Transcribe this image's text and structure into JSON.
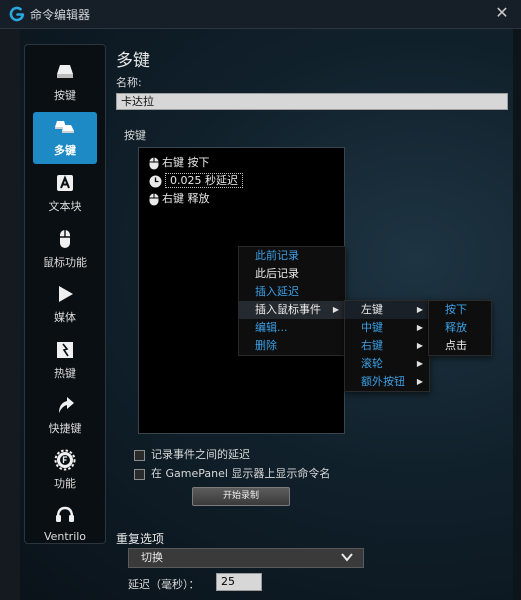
{
  "window": {
    "title": "命令编辑器"
  },
  "sidebar": {
    "items": [
      {
        "label": "按键",
        "icon": "key-icon",
        "active": false
      },
      {
        "label": "多键",
        "icon": "multi-key-icon",
        "active": true
      },
      {
        "label": "文本块",
        "icon": "text-block-icon",
        "active": false
      },
      {
        "label": "鼠标功能",
        "icon": "mouse-icon",
        "active": false
      },
      {
        "label": "媒体",
        "icon": "media-play-icon",
        "active": false
      },
      {
        "label": "热键",
        "icon": "hotkey-icon",
        "active": false
      },
      {
        "label": "快捷键",
        "icon": "shortcut-arrow-icon",
        "active": false
      },
      {
        "label": "功能",
        "icon": "function-gear-icon",
        "active": false
      },
      {
        "label": "Ventrilo",
        "icon": "headset-icon",
        "active": false
      }
    ]
  },
  "main": {
    "title": "多键",
    "name_label": "名称:",
    "name_value": "卡达拉",
    "keys_label": "按键",
    "events": [
      {
        "icon": "mouse-icon",
        "text": "右键 按下"
      },
      {
        "icon": "clock-icon",
        "text": "0.025 秒延迟"
      },
      {
        "icon": "mouse-icon",
        "text": "右键 释放"
      }
    ],
    "checkbox_record_delay": "记录事件之间的延迟",
    "checkbox_show_name": "在 GamePanel 显示器上显示命令名",
    "record_button": "开始录制"
  },
  "context_menu": {
    "items": [
      {
        "label": "此前记录",
        "color": "blue"
      },
      {
        "label": "此后记录",
        "color": "white"
      },
      {
        "label": "插入延迟",
        "color": "blue"
      },
      {
        "label": "插入鼠标事件",
        "color": "white",
        "has_submenu": true
      },
      {
        "label": "编辑...",
        "color": "blue"
      },
      {
        "label": "删除",
        "color": "blue"
      }
    ]
  },
  "submenu_mouse": {
    "items": [
      {
        "label": "左键",
        "color": "white",
        "has_submenu": true
      },
      {
        "label": "中键",
        "color": "blue",
        "has_submenu": true
      },
      {
        "label": "右键",
        "color": "blue",
        "has_submenu": true
      },
      {
        "label": "滚轮",
        "color": "blue",
        "has_submenu": true
      },
      {
        "label": "额外按钮",
        "color": "blue",
        "has_submenu": true
      }
    ]
  },
  "submenu_left": {
    "items": [
      {
        "label": "按下",
        "color": "blue"
      },
      {
        "label": "释放",
        "color": "blue"
      },
      {
        "label": "点击",
        "color": "white"
      }
    ]
  },
  "repeat": {
    "title": "重复选项",
    "selected": "切换",
    "delay_label": "延迟（毫秒）：",
    "delay_value": "25"
  },
  "colors": {
    "accent": "#1d8ac6",
    "menu_link": "#3aa0e6"
  }
}
